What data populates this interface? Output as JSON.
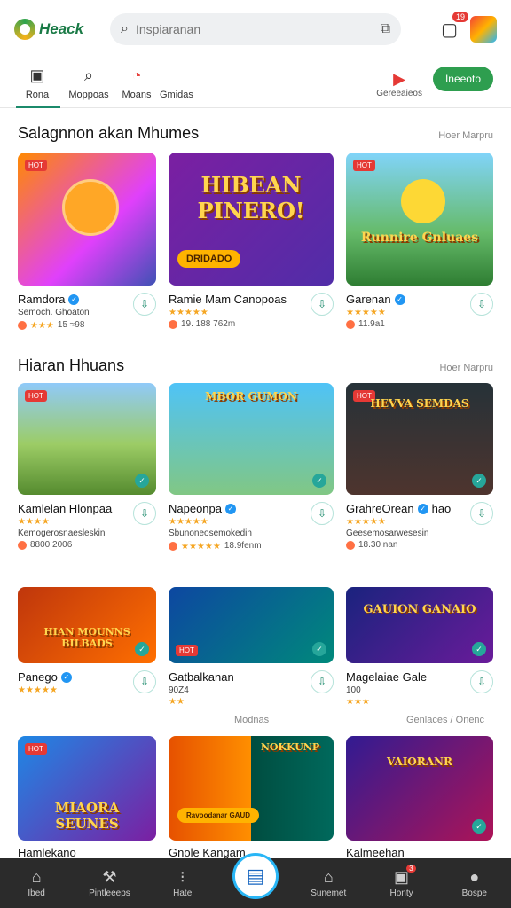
{
  "header": {
    "logo_text": "Heack",
    "search_placeholder": "Inspiaranan",
    "cart_badge": "19"
  },
  "tabs": [
    {
      "label": "Rona"
    },
    {
      "label": "Moppoas"
    },
    {
      "label": "Moans"
    },
    {
      "label": "Gmidas"
    }
  ],
  "tabs_right": {
    "comp_label": "Gereeaieos",
    "primary_button": "Ineeoto"
  },
  "section1": {
    "title": "Salagnnon akan Mhumes",
    "see_all": "Hoer Marpru",
    "cards": [
      {
        "tag": "HOT",
        "thumb_title": "",
        "name": "Ramdora",
        "verified": true,
        "sub": "Semoch. Ghoaton",
        "stars": "★★★",
        "meta": "15 ≈98",
        "theme": "orange"
      },
      {
        "tag": "",
        "thumb_title": "HIBEAN PINERO!",
        "cta": "DRIDADO",
        "name": "Ramie Mam Canopoas",
        "verified": false,
        "sub": "",
        "stars": "★★★★★",
        "meta": "19. 188 762m",
        "theme": "purple"
      },
      {
        "tag": "HOT",
        "thumb_title": "Runnire Gnluaes",
        "name": "Garenan",
        "verified": true,
        "sub": "",
        "stars": "★★★★★",
        "meta": "11.9a1",
        "theme": "green"
      }
    ]
  },
  "section2": {
    "title": "Hiaran Hhuans",
    "see_all": "Hoer Narpru",
    "cards": [
      {
        "tag": "HOT",
        "thumb_title": "",
        "name": "Kamlelan Hlonpaa",
        "verified": false,
        "sub": "Kemogerosnaesleskin",
        "stars": "★★★★",
        "meta": "8800 2006",
        "theme": "field"
      },
      {
        "tag": "",
        "thumb_title": "MBOR GUMON",
        "name": "Napeonpa",
        "verified": true,
        "sub": "Sbunoneosemokedin",
        "stars": "★★★★★",
        "meta": "18.9fenm",
        "theme": "sky"
      },
      {
        "tag": "HOT",
        "thumb_title": "HEVVA SEMDAS",
        "name": "GrahreOrean",
        "verified": true,
        "sub": "Geesemosarwesesin",
        "stars": "★★★★★",
        "meta": "18.30 nan",
        "theme": "dark",
        "name_suffix": "hao"
      }
    ]
  },
  "section3": {
    "cards": [
      {
        "tag": "",
        "thumb_title": "HIAN MOUNNS BILBADS",
        "name": "Panego",
        "verified": true,
        "sub": "",
        "stars": "★★★★★",
        "meta": "",
        "theme": "fire"
      },
      {
        "tag": "HOT",
        "thumb_title": "",
        "name": "Gatbalkanan",
        "verified": false,
        "sub": "90Z4",
        "stars": "★★",
        "meta": "",
        "theme": "arena"
      },
      {
        "tag": "",
        "thumb_title": "GAUION GANAIO",
        "name": "Magelaiae Gale",
        "verified": false,
        "sub": "100",
        "stars": "★★★",
        "meta": "",
        "theme": "bluearena"
      }
    ]
  },
  "mid_labels": {
    "left": "Modnas",
    "right": "Genlaces / Onenc"
  },
  "section4": {
    "cards": [
      {
        "tag": "HOT",
        "thumb_title": "MIAORA SEUNES",
        "name": "Hamlekano",
        "theme": "blue"
      },
      {
        "tag": "",
        "thumb_title": "NOKKUNP",
        "name": "Gnole Kangam",
        "theme": "split",
        "cta": "Ravoodanar GAUD"
      },
      {
        "tag": "",
        "thumb_title": "VAIORANR",
        "name": "Kalmeehan",
        "theme": "violet"
      }
    ]
  },
  "bottom_nav": [
    {
      "label": "Ibed",
      "icon": "home-icon"
    },
    {
      "label": "Pintleeeps",
      "icon": "hammer-icon"
    },
    {
      "label": "Hate",
      "icon": "dots-icon"
    },
    {
      "label": "",
      "icon": "center-gamepad-icon"
    },
    {
      "label": "Sunemet",
      "icon": "store-icon"
    },
    {
      "label": "Honty",
      "icon": "gift-icon",
      "badge": "3"
    },
    {
      "label": "Bospe",
      "icon": "profile-icon"
    }
  ],
  "colors": {
    "accent": "#2e9e4f",
    "badge": "#e53935",
    "star": "#f5a623",
    "nav_bg": "#2b2b2b"
  }
}
